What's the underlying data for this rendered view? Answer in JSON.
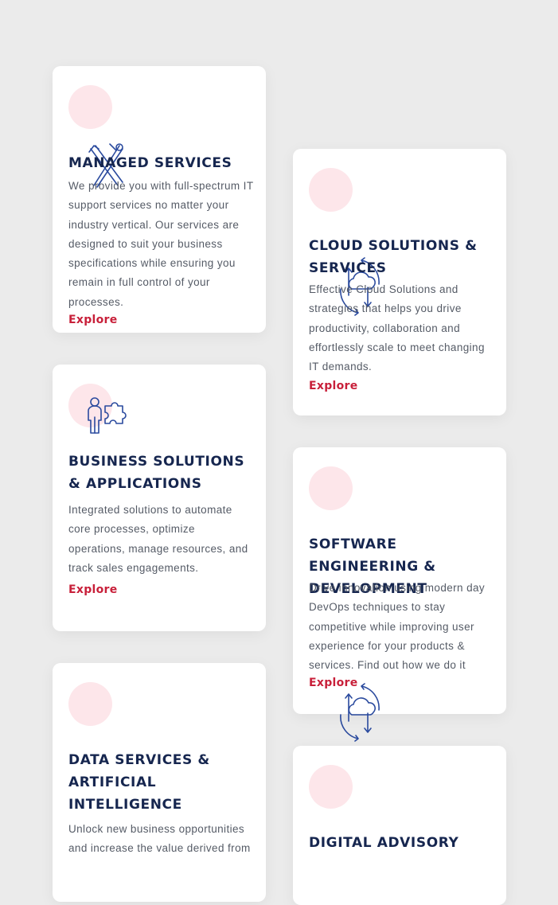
{
  "cards": [
    {
      "title": "MANAGED SERVICES",
      "description": "We provide you with full-spectrum IT support services no matter your industry vertical. Our services are designed to suit your business specifications while ensuring you remain in full control of your processes.",
      "link": "Explore",
      "icon": "tools-icon"
    },
    {
      "title": "CLOUD SOLUTIONS & SERVICES",
      "description": "Effective Cloud Solutions and strategies that helps you drive productivity, collaboration and effortlessly scale to meet changing IT demands.",
      "link": "Explore",
      "icon": "cloud-sync-icon"
    },
    {
      "title": "BUSINESS SOLUTIONS & APPLICATIONS",
      "description": "Integrated solutions to automate core processes, optimize operations, manage resources, and track sales engagements.",
      "link": "Explore",
      "icon": "person-puzzle-icon"
    },
    {
      "title": "SOFTWARE ENGINEERING & DEVELOPMENT",
      "description": "Drive innovation using modern day DevOps techniques to stay competitive while improving user experience for your products & services. Find out how we do it",
      "link": "Explore",
      "icon": "cloud-sync-icon"
    },
    {
      "title": "DATA SERVICES & ARTIFICIAL INTELLIGENCE",
      "description": "Unlock new business opportunities and increase the value derived from",
      "link": "",
      "icon": ""
    },
    {
      "title": "DIGITAL ADVISORY",
      "description": "",
      "link": "",
      "icon": ""
    }
  ],
  "colors": {
    "background": "#ebebeb",
    "card": "#ffffff",
    "title": "#16264f",
    "text": "#555b66",
    "link": "#c8203a",
    "icon_circle": "#fde6ea",
    "icon_stroke": "#2a4a9e"
  }
}
